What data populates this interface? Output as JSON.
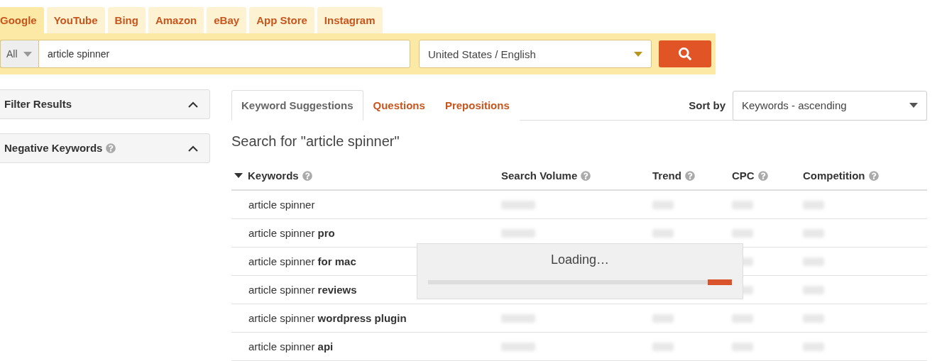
{
  "engine_tabs": [
    {
      "label": "Google",
      "selected": true
    },
    {
      "label": "YouTube",
      "selected": false
    },
    {
      "label": "Bing",
      "selected": false
    },
    {
      "label": "Amazon",
      "selected": false
    },
    {
      "label": "eBay",
      "selected": false
    },
    {
      "label": "App Store",
      "selected": false
    },
    {
      "label": "Instagram",
      "selected": false
    }
  ],
  "search": {
    "scope": "All",
    "value": "article spinner",
    "language": "United States / English"
  },
  "sidebar": {
    "panels": [
      {
        "title": "Filter Results",
        "help": false,
        "expanded": true
      },
      {
        "title": "Negative Keywords",
        "help": true,
        "expanded": true
      }
    ]
  },
  "result_tabs": [
    {
      "label": "Keyword Suggestions",
      "selected": true
    },
    {
      "label": "Questions",
      "selected": false
    },
    {
      "label": "Prepositions",
      "selected": false
    }
  ],
  "sort": {
    "label": "Sort by",
    "value": "Keywords - ascending"
  },
  "heading": "Search for \"article spinner\"",
  "table": {
    "columns": [
      {
        "label": "Keywords",
        "sorted": true
      },
      {
        "label": "Search Volume",
        "sorted": false
      },
      {
        "label": "Trend",
        "sorted": false
      },
      {
        "label": "CPC",
        "sorted": false
      },
      {
        "label": "Competition",
        "sorted": false
      }
    ],
    "rows": [
      {
        "keyword": "article spinner"
      },
      {
        "keyword": "article spinner **pro**"
      },
      {
        "keyword": "article spinner **for mac**"
      },
      {
        "keyword": "article spinner **reviews**"
      },
      {
        "keyword": "article spinner **wordpress plugin**"
      },
      {
        "keyword": "article spinner **api**"
      }
    ]
  },
  "loading": {
    "text": "Loading…"
  }
}
